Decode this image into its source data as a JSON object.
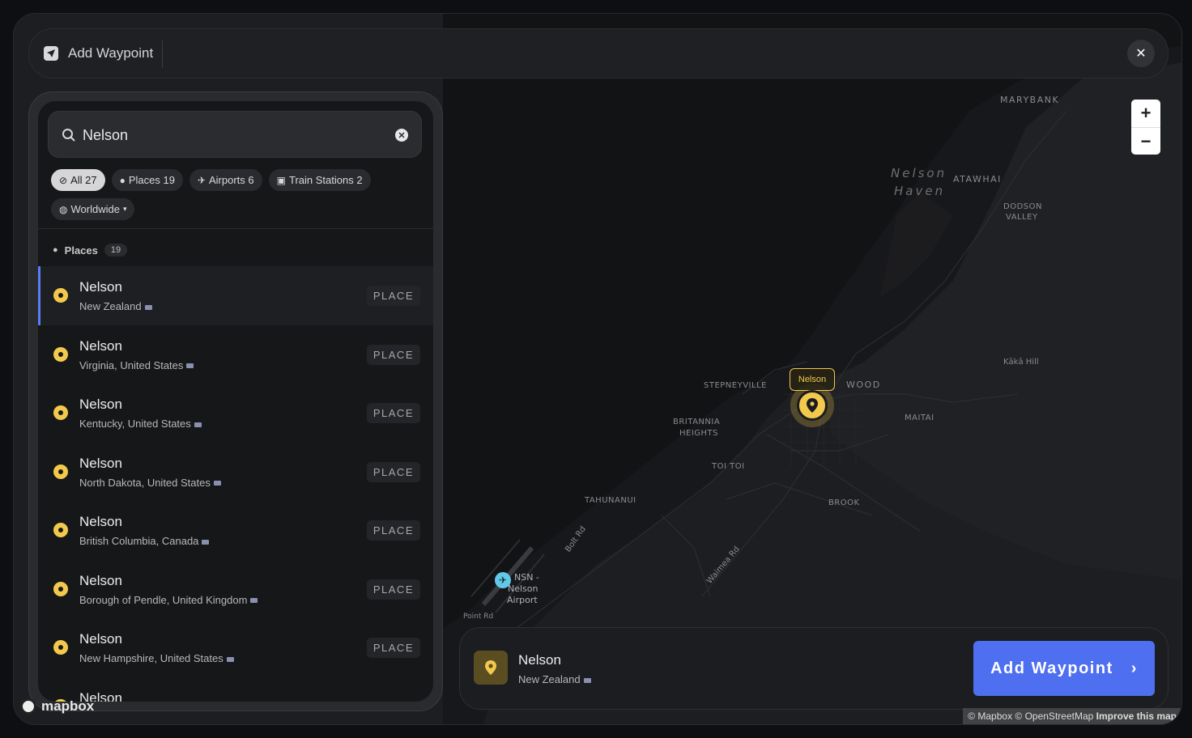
{
  "header": {
    "title": "Add Waypoint",
    "close_icon": "close-icon"
  },
  "search": {
    "value": "Nelson",
    "placeholder": "Search"
  },
  "filters": [
    {
      "label": "All 27",
      "icon": "compass-icon",
      "active": true
    },
    {
      "label": "Places 19",
      "icon": "pin-icon",
      "active": false
    },
    {
      "label": "Airports 6",
      "icon": "plane-icon",
      "active": false
    },
    {
      "label": "Train Stations 2",
      "icon": "train-icon",
      "active": false
    }
  ],
  "scope": {
    "label": "Worldwide"
  },
  "section": {
    "label": "Places",
    "count": "19"
  },
  "results": [
    {
      "name": "Nelson",
      "sub": "New Zealand",
      "tag": "PLACE"
    },
    {
      "name": "Nelson",
      "sub": "Virginia, United States",
      "tag": "PLACE"
    },
    {
      "name": "Nelson",
      "sub": "Kentucky, United States",
      "tag": "PLACE"
    },
    {
      "name": "Nelson",
      "sub": "North Dakota, United States",
      "tag": "PLACE"
    },
    {
      "name": "Nelson",
      "sub": "British Columbia, Canada",
      "tag": "PLACE"
    },
    {
      "name": "Nelson",
      "sub": "Borough of Pendle, United Kingdom",
      "tag": "PLACE"
    },
    {
      "name": "Nelson",
      "sub": "New Hampshire, United States",
      "tag": "PLACE"
    },
    {
      "name": "Nelson",
      "sub": "",
      "tag": ""
    }
  ],
  "map": {
    "labels": {
      "marybank": "MARYBANK",
      "haven1": "Nelson",
      "haven2": "Haven",
      "atawhai": "ATAWHAI",
      "dodson1": "DODSON",
      "dodson2": "VALLEY",
      "kaka": "Kākā Hill",
      "stepneyville": "STEPNEYVILLE",
      "wood": "WOOD",
      "maitai": "MAITAI",
      "britannia1": "BRITANNIA",
      "britannia2": "HEIGHTS",
      "toitoi": "TOI TOI",
      "tahunanui": "TAHUNANUI",
      "brook": "BROOK",
      "boltrd": "Bolt Rd",
      "waimea": "Waimea Rd",
      "pointrd": "Point Rd",
      "nsn1": "NSN -",
      "nsn2": "Nelson",
      "nsn3": "Airport"
    },
    "marker_label": "Nelson",
    "zoom_in": "+",
    "zoom_out": "−"
  },
  "selection": {
    "name": "Nelson",
    "sub": "New Zealand",
    "button": "Add Waypoint"
  },
  "footer": {
    "logo": "mapbox",
    "attribution": "© Mapbox © OpenStreetMap",
    "improve": "Improve this map"
  },
  "colors": {
    "accent": "#4e6ff0",
    "pin": "#f2c94c",
    "selected_bar": "#5b7cf5"
  }
}
